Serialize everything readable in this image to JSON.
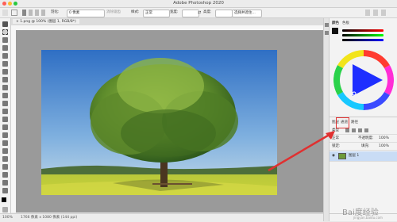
{
  "window": {
    "title": "Adobe Photoshop 2020"
  },
  "options_bar": {
    "feather_label": "羽化:",
    "feather_value": "0 像素",
    "antialias_label": "消除锯齿",
    "style_label": "样式:",
    "style_value": "正常",
    "width_label": "宽度:",
    "height_label": "高度:",
    "select_mask_button": "选择并遮住..."
  },
  "document_tab": {
    "label": "1.png @ 100% (图层 1, RGB/8*)"
  },
  "status_bar": {
    "zoom": "100%",
    "doc_info": "1766 像素 x 1080 像素 (144 ppi)"
  },
  "color_panel": {
    "tab1": "颜色",
    "tab2": "色板"
  },
  "layers_panel": {
    "tab_layers": "图层",
    "tab_channels": "通道",
    "tab_paths": "路径",
    "kind_label": "类型",
    "blend_mode": "正常",
    "opacity_label": "不透明度:",
    "opacity_value": "100%",
    "lock_label": "锁定:",
    "fill_label": "填充:",
    "fill_value": "100%",
    "layers": [
      {
        "name": "图层 1"
      }
    ]
  },
  "watermark": {
    "text": "Bai度经验",
    "sub": "jingyan.baidu.com"
  },
  "colors": {
    "accent_red": "#e03030",
    "hue_wheel": true
  }
}
